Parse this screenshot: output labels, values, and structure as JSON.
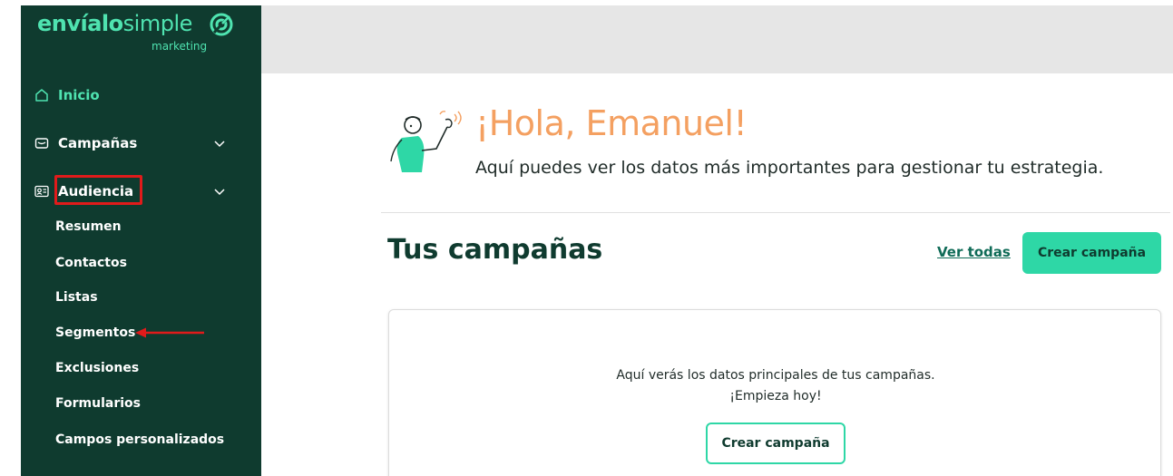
{
  "brand": {
    "name_bold": "envíalo",
    "name_light": "simple",
    "tagline": "marketing",
    "accent_color": "#4fe3b0",
    "sidebar_color": "#0f3b2f"
  },
  "sidebar": {
    "items": [
      {
        "label": "Inicio",
        "icon": "home-icon"
      },
      {
        "label": "Campañas",
        "icon": "campaign-icon"
      },
      {
        "label": "Audiencia",
        "icon": "contact-card-icon"
      }
    ],
    "audiencia_subitems": [
      "Resumen",
      "Contactos",
      "Listas",
      "Segmentos",
      "Exclusiones",
      "Formularios",
      "Campos personalizados"
    ]
  },
  "header": {
    "greeting": "¡Hola, Emanuel!",
    "subtitle": "Aquí puedes ver los datos más importantes para gestionar tu estrategia."
  },
  "campaigns": {
    "title": "Tus campañas",
    "view_all": "Ver todas",
    "create_button": "Crear campaña",
    "empty_line1": "Aquí verás los datos principales de tus campañas.",
    "empty_line2": "¡Empieza hoy!",
    "empty_button": "Crear campaña"
  },
  "colors": {
    "primary_button": "#2ed7a6",
    "greeting": "#f4a061",
    "annotation": "#e01b1b"
  }
}
